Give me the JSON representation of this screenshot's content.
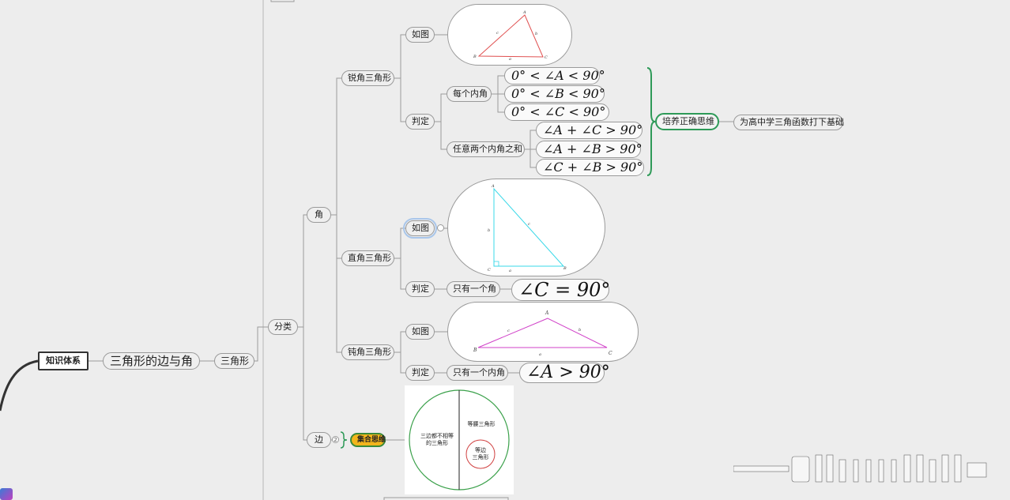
{
  "root": {
    "label": "知识体系"
  },
  "topic": {
    "label": "三角形的边与角"
  },
  "triangle": {
    "label": "三角形"
  },
  "classify": {
    "label": "分类"
  },
  "angle": {
    "label": "角"
  },
  "side": {
    "label": "边",
    "collapsed_count": "2"
  },
  "acute": {
    "label": "锐角三角形",
    "figure_label": "如图",
    "judge_label": "判定",
    "each_angle_label": "每个内角",
    "each_angle_conditions": [
      "0° < ∠A < 90°",
      "0° < ∠B < 90°",
      "0° < ∠C < 90°"
    ],
    "sum_label": "任意两个内角之和",
    "sum_conditions": [
      "∠A + ∠C > 90°",
      "∠A + ∠B > 90°",
      "∠C + ∠B > 90°"
    ],
    "vertex_labels": [
      "A",
      "B",
      "C"
    ],
    "side_labels": [
      "a",
      "b",
      "c"
    ]
  },
  "right": {
    "label": "直角三角形",
    "figure_label": "如图",
    "judge_label": "判定",
    "only_one_label": "只有一个角",
    "condition": "∠C = 90°",
    "vertex_labels": [
      "A",
      "B",
      "C"
    ],
    "side_labels": [
      "a",
      "b",
      "c"
    ]
  },
  "obtuse": {
    "label": "钝角三角形",
    "figure_label": "如图",
    "judge_label": "判定",
    "only_one_label": "只有一个内角",
    "condition": "∠A > 90°",
    "vertex_labels": [
      "A",
      "B",
      "C"
    ],
    "side_labels": [
      "a",
      "b",
      "c"
    ]
  },
  "set_thinking": {
    "label": "集合思维",
    "venn": {
      "left_label": [
        "三边都不相等",
        "的三角形"
      ],
      "right_label": "等腰三角形",
      "inner_label": [
        "等边",
        "三角形"
      ]
    }
  },
  "summary": {
    "label": "培养正确思维",
    "note": "为高中学三角函数打下基础"
  },
  "colors": {
    "acute_triangle": "#e05050",
    "right_triangle": "#38d8e8",
    "obtuse_triangle": "#d040c8",
    "bracket": "#2e9a58",
    "venn_circle": "#3aa04a",
    "venn_inner": "#d04040"
  }
}
